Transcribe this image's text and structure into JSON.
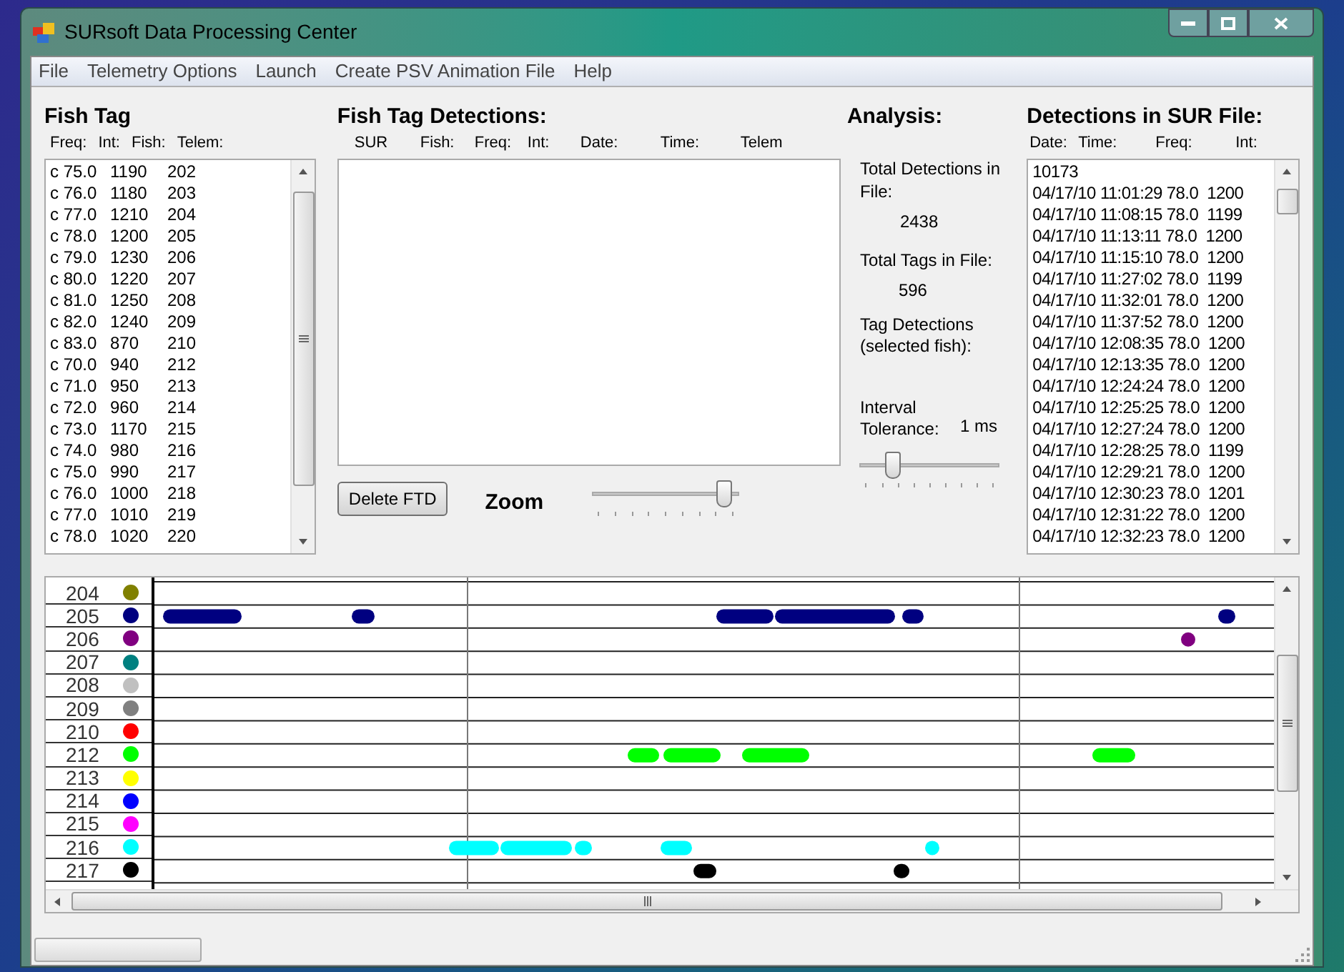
{
  "window": {
    "title": "SURsoft Data Processing Center"
  },
  "menu": [
    "File",
    "Telemetry Options",
    "Launch",
    "Create PSV Animation File",
    "Help"
  ],
  "fish_tag": {
    "title": "Fish Tag",
    "columns": [
      "Freq:",
      "Int:",
      "Fish:",
      "Telem:"
    ],
    "rows": [
      [
        "c 75.0",
        "1190",
        "202"
      ],
      [
        "c 76.0",
        "1180",
        "203"
      ],
      [
        "c 77.0",
        "1210",
        "204"
      ],
      [
        "c 78.0",
        "1200",
        "205"
      ],
      [
        "c 79.0",
        "1230",
        "206"
      ],
      [
        "c 80.0",
        "1220",
        "207"
      ],
      [
        "c 81.0",
        "1250",
        "208"
      ],
      [
        "c 82.0",
        "1240",
        "209"
      ],
      [
        "c 83.0",
        "870",
        "210"
      ],
      [
        "c 70.0",
        "940",
        "212"
      ],
      [
        "c 71.0",
        "950",
        "213"
      ],
      [
        "c 72.0",
        "960",
        "214"
      ],
      [
        "c 73.0",
        "1170",
        "215"
      ],
      [
        "c 74.0",
        "980",
        "216"
      ],
      [
        "c 75.0",
        "990",
        "217"
      ],
      [
        "c 76.0",
        "1000",
        "218"
      ],
      [
        "c 77.0",
        "1010",
        "219"
      ],
      [
        "c 78.0",
        "1020",
        "220"
      ]
    ]
  },
  "detections": {
    "title": "Fish Tag Detections:",
    "columns": [
      "SUR",
      "Fish:",
      "Freq:",
      "Int:",
      "Date:",
      "Time:",
      "Telem"
    ],
    "delete_button": "Delete FTD",
    "zoom": {
      "label": "Zoom",
      "level": 0.95
    }
  },
  "analysis": {
    "title": "Analysis:",
    "total_detections_label": "Total Detections in File:",
    "total_detections": "2438",
    "total_tags_label": "Total Tags in File:",
    "total_tags": "596",
    "tag_detections_label": "Tag Detections (selected fish):",
    "interval_label": "Interval Tolerance:",
    "interval_value": "1 ms",
    "interval_slider": {
      "level": 0.2
    }
  },
  "sur_file": {
    "title": "Detections in SUR File:",
    "columns": [
      "Date:",
      "Time:",
      "Freq:",
      "Int:"
    ],
    "rows": [
      "10173",
      "04/17/10 11:01:29 78.0  1200",
      "04/17/10 11:08:15 78.0  1199",
      "04/17/10 11:13:11 78.0  1200",
      "04/17/10 11:15:10 78.0  1200",
      "04/17/10 11:27:02 78.0  1199",
      "04/17/10 11:32:01 78.0  1200",
      "04/17/10 11:37:52 78.0  1200",
      "04/17/10 12:08:35 78.0  1200",
      "04/17/10 12:13:35 78.0  1200",
      "04/17/10 12:24:24 78.0  1200",
      "04/17/10 12:25:25 78.0  1200",
      "04/17/10 12:27:24 78.0  1200",
      "04/17/10 12:28:25 78.0  1199",
      "04/17/10 12:29:21 78.0  1200",
      "04/17/10 12:30:23 78.0  1201",
      "04/17/10 12:31:22 78.0  1200",
      "04/17/10 12:32:23 78.0  1200"
    ]
  },
  "timeline": {
    "tracks": [
      {
        "fish": "204",
        "color": "#808000"
      },
      {
        "fish": "205",
        "color": "#000080"
      },
      {
        "fish": "206",
        "color": "#800080"
      },
      {
        "fish": "207",
        "color": "#008080"
      },
      {
        "fish": "208",
        "color": "#c0c0c0"
      },
      {
        "fish": "209",
        "color": "#808080"
      },
      {
        "fish": "210",
        "color": "#ff0000"
      },
      {
        "fish": "212",
        "color": "#00ff00"
      },
      {
        "fish": "213",
        "color": "#ffff00"
      },
      {
        "fish": "214",
        "color": "#0000ff"
      },
      {
        "fish": "215",
        "color": "#ff00ff"
      },
      {
        "fish": "216",
        "color": "#00ffff"
      },
      {
        "fish": "217",
        "color": "#000000"
      }
    ]
  },
  "status_bar": {
    "progress": {
      "level": 0
    }
  }
}
